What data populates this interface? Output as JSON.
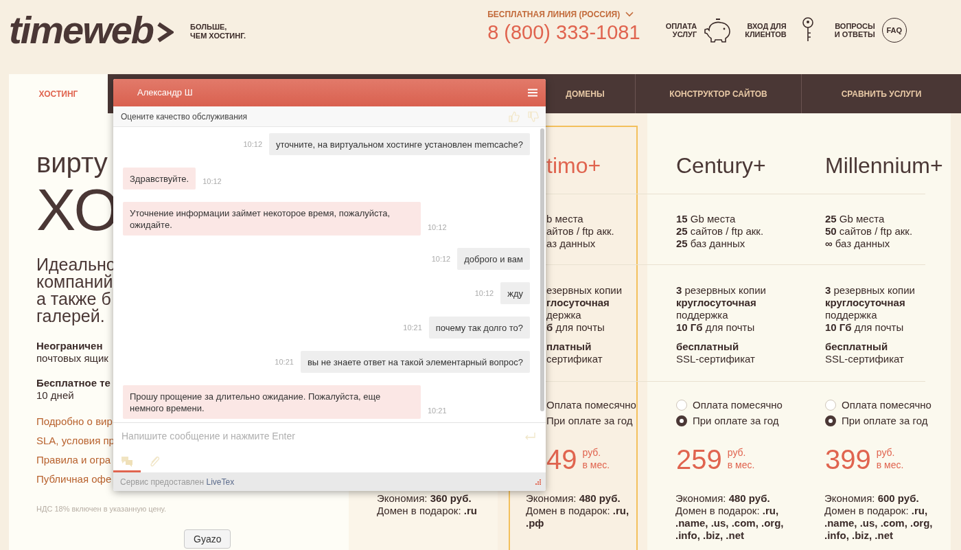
{
  "header": {
    "logo": "timeweb",
    "tagline": "БОЛЬШЕ,\nЧЕМ ХОСТИНГ.",
    "hotline_label": "БЕСПЛАТНАЯ ЛИНИЯ (РОССИЯ)",
    "phone": "8 (800) 333-1081",
    "links": [
      {
        "kind": "payment",
        "label": "ОПЛАТА\nУСЛУГ"
      },
      {
        "kind": "login",
        "label": "ВХОД ДЛЯ\nКЛИЕНТОВ"
      },
      {
        "kind": "faq",
        "label": "ВОПРОСЫ\nИ ОТВЕТЫ",
        "icon_text": "FAQ"
      }
    ]
  },
  "nav": {
    "tabs": [
      {
        "label": "ХОСТИНГ",
        "selected": true
      },
      {
        "label": "ДОМЕНЫ",
        "selected": false
      },
      {
        "label": "КОНСТРУКТОР САЙТОВ",
        "selected": false
      },
      {
        "label": "СРАВНИТЬ УСЛУГИ",
        "selected": false
      }
    ]
  },
  "hero": {
    "title_line1": "вирту",
    "title_line2": "ХО",
    "intro_lines": [
      "Идеально",
      "компаний",
      "а также б",
      "галерей."
    ],
    "features": [
      {
        "title": "Неограничен",
        "text": "почтовых ящик"
      },
      {
        "title": "Бесплатное те",
        "text": "10 дней"
      }
    ],
    "links": [
      "Подробно о вир",
      "SLA, условия пр",
      "Правила и огра",
      "Публичная офе"
    ],
    "note": "НДС 18% включен в указанную цену."
  },
  "plans": [
    {
      "savings": "Экономия: **360 руб.**",
      "domains": "Домен в подарок: **.ru**"
    },
    {
      "name": "timo+",
      "highlighted": true,
      "specs": [
        "b места",
        "айтов / ftp акк.",
        "аз данных"
      ],
      "extras": [
        "езервных копии",
        "**глосуточная**",
        "держка",
        "**б** для почты"
      ],
      "ssl": [
        "**платный**",
        "сертификат"
      ],
      "billing": [
        {
          "label": "Оплата помесячно"
        },
        {
          "label": "При оплате за год"
        }
      ],
      "price": "49",
      "currency": "руб.",
      "period": "в мес.",
      "savings": "Экономия: **480 руб.**",
      "domains": "Домен в подарок: **.ru, .рф**"
    },
    {
      "name": "Century+",
      "highlighted": false,
      "specs": [
        "**15** Gb места",
        "**25** сайтов / ftp акк.",
        "**25** баз данных"
      ],
      "extras": [
        "**3** резервных копии",
        "**круглосуточная**",
        "поддержка",
        "**10 Гб** для почты"
      ],
      "ssl": [
        "**бесплатный**",
        "SSL-сертификат"
      ],
      "billing": [
        {
          "label": "Оплата помесячно",
          "selected": false
        },
        {
          "label": "При оплате за год",
          "selected": true
        }
      ],
      "price": "259",
      "currency": "руб.",
      "period": "в мес.",
      "savings": "Экономия: **480 руб.**",
      "domains": "Домен в подарок: **.ru, .name, .us, .com, .org, .info, .biz, .net**"
    },
    {
      "name": "Millennium+",
      "highlighted": false,
      "specs": [
        "**25** Gb места",
        "**50** сайтов / ftp акк.",
        "**∞** баз данных"
      ],
      "extras": [
        "**3** резервных копии",
        "**круглосуточная**",
        "поддержка",
        "**10 Гб** для почты"
      ],
      "ssl": [
        "**бесплатный**",
        "SSL-сертификат"
      ],
      "billing": [
        {
          "label": "Оплата помесячно",
          "selected": false
        },
        {
          "label": "При оплате за год",
          "selected": true
        }
      ],
      "price": "399",
      "currency": "руб.",
      "period": "в мес.",
      "savings": "Экономия: **600 руб.**",
      "domains": "Домен в подарок: **.ru, .name, .us, .com, .org, .info, .biz, .net**"
    }
  ],
  "chat": {
    "agent": "Александр Ш",
    "rating_prompt": "Оцените качество обслуживания",
    "messages": [
      {
        "kind": "visitor",
        "text": "уточните, на виртуальном хостинге установлен memcache?",
        "time": "10:12"
      },
      {
        "kind": "agent",
        "text": "Здравствуйте.",
        "time": "10:12"
      },
      {
        "kind": "agent",
        "text": "Уточнение информации займет некоторое время, пожалуйста, ожидайте.",
        "time": "10:12"
      },
      {
        "kind": "visitor",
        "text": "доброго и вам",
        "time": "10:12"
      },
      {
        "kind": "visitor",
        "text": "жду",
        "time": "10:12"
      },
      {
        "kind": "visitor",
        "text": "почему так долго то?",
        "time": "10:21"
      },
      {
        "kind": "visitor",
        "text": "вы не знаете ответ на такой элементарный вопрос?",
        "time": "10:21"
      },
      {
        "kind": "agent",
        "text": "Прошу прощение за длительно ожидание. Пожалуйста, еще немного времени.",
        "time": "10:21"
      }
    ],
    "input_placeholder": "Напишите сообщение и нажмите Enter",
    "tabs": [
      {
        "kind": "messages",
        "selected": true
      },
      {
        "kind": "attach",
        "selected": false
      }
    ],
    "footer_text": "Сервис предоставлен",
    "footer_link": "LiveTex"
  },
  "tooltip": "Gyazo"
}
